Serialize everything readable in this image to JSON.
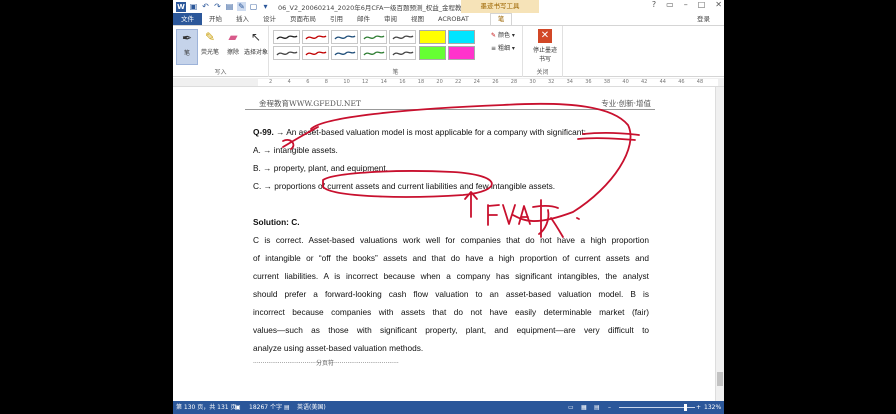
{
  "window": {
    "title": "06_V2_20060214_2020年6月CFA一级百题预测_权益_金程教育 (模...",
    "context_tab": "墨迹书写工具",
    "sign_in": "登录"
  },
  "ribbon": {
    "tabs": [
      "文件",
      "开始",
      "插入",
      "设计",
      "页面布局",
      "引用",
      "邮件",
      "审阅",
      "视图",
      "ACROBAT",
      "笔"
    ],
    "active_tab": "笔",
    "tools": {
      "pen": "笔",
      "highlighter": "荧光笔",
      "eraser": "擦除",
      "select": "选择对象"
    },
    "color_label": "颜色",
    "thickness_label": "粗细",
    "stop_label": "停止墨迹书写",
    "groups": {
      "write": "写入",
      "pens": "笔",
      "close": "关闭"
    },
    "pen_colors": [
      "#222222",
      "#c00000",
      "#1f4e79",
      "#2e7d32",
      "#444444",
      "#444444",
      "#c00000",
      "#1f4e79",
      "#2e7d32",
      "#444444"
    ],
    "highlight_colors": [
      "#ffff00",
      "#00e5ff",
      "#66ff33",
      "#ff33cc"
    ]
  },
  "ruler": {
    "ticks": [
      "2",
      "4",
      "6",
      "8",
      "10",
      "12",
      "14",
      "16",
      "18",
      "20",
      "22",
      "24",
      "26",
      "28",
      "30",
      "32",
      "34",
      "36",
      "38",
      "40",
      "42",
      "44",
      "46",
      "48"
    ]
  },
  "document": {
    "header_left": "金程教育WWW.GFEDU.NET",
    "header_right": "专业·创新·增值",
    "question_num": "Q-99.",
    "question": "→ An asset-based valuation model is most applicable for a company with significant:",
    "option_a": "A. → intangible assets.",
    "option_b": "B. → property, plant, and equipment.",
    "option_c": "C. → proportions of current assets and current liabilities and few intangible assets.",
    "solution_label": "Solution: C.",
    "body_lines": [
      "C is correct. Asset-based valuations work well for companies that do not have a high proportion",
      "of intangible or “off the books” assets and that do have a high proportion of current assets and",
      "current liabilities. A is incorrect because when a company has significant intangibles, the analyst",
      "should prefer a forward-looking cash flow valuation to an asset-based valuation model. B is",
      "incorrect because companies with assets that do not have easily determinable market (fair)",
      "values—such as those with significant property, plant, and equipment—are very difficult to",
      "analyze using asset-based valuation methods."
    ],
    "page_break": "分页符",
    "ink_note": "FVA 低"
  },
  "status": {
    "page": "第 130 页，共 131 页",
    "words": "18267 个字",
    "language": "英语(美国)",
    "zoom": "132%"
  }
}
